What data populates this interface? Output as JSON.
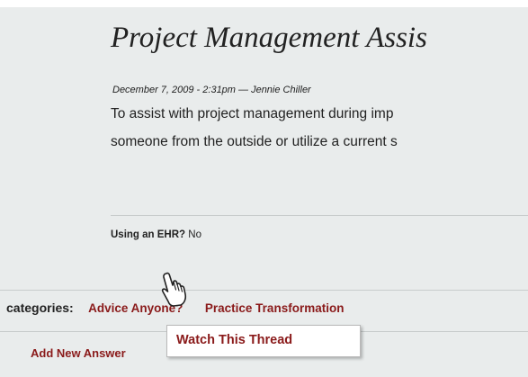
{
  "post": {
    "title": "Project Management Assis",
    "meta": "December 7, 2009 - 2:31pm — Jennie Chiller",
    "body_line1": "To assist with project management during imp",
    "body_line2": "someone from the outside or utilize a current s"
  },
  "ehr": {
    "label": "Using an EHR?",
    "value": "No"
  },
  "categories": {
    "label": "categories:",
    "items": [
      {
        "label": "Advice Anyone?"
      },
      {
        "label": "Practice Transformation"
      }
    ]
  },
  "actions": {
    "add_answer": "Add New Answer"
  },
  "tooltip": {
    "label": "Watch This Thread"
  },
  "cursor": {
    "icon": "hand-pointer-icon"
  },
  "colors": {
    "panel_bg": "#e9ecec",
    "link": "#8a1a1a",
    "text": "#222222"
  }
}
